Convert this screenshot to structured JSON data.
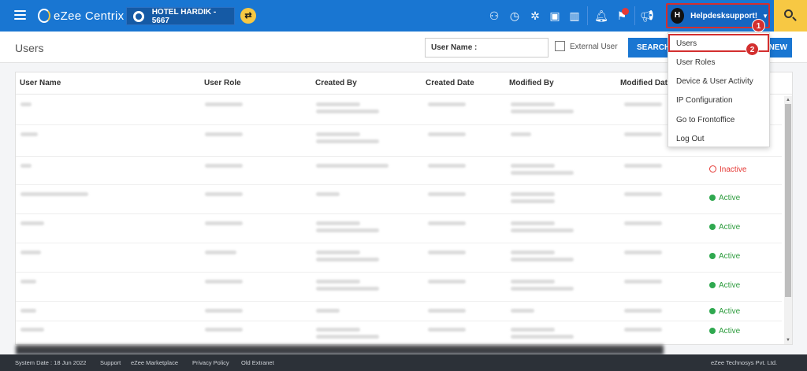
{
  "topbar": {
    "app_name": "eZee Centrix",
    "hotel_label": "HOTEL HARDIK -  5667",
    "user_initial": "H",
    "user_name": "Helpdesksupport!",
    "notification_badge": "",
    "icons": [
      "menu-icon",
      "hotel-globe-icon",
      "swap-icon",
      "team-icon",
      "calendar-icon",
      "network-icon",
      "clipboard-icon",
      "report-chart-icon",
      "bell-icon",
      "flag-icon",
      "megaphone-icon",
      "search-icon"
    ]
  },
  "subheader": {
    "title": "Users",
    "username_placeholder": "User Name :",
    "external_user_label": "External User",
    "search_label": "SEARCH",
    "new_label": "NEW"
  },
  "table": {
    "columns": [
      "User Name",
      "User Role",
      "Created By",
      "Created Date",
      "Modified By",
      "Modified Date"
    ],
    "rows": [
      {
        "status": ""
      },
      {
        "status": ""
      },
      {
        "status": "Inactive"
      },
      {
        "status": "Active"
      },
      {
        "status": "Active"
      },
      {
        "status": "Active"
      },
      {
        "status": "Active"
      },
      {
        "status": "Active"
      },
      {
        "status": "Active"
      }
    ]
  },
  "user_menu": {
    "items": [
      "Users",
      "User Roles",
      "Device & User Activity",
      "IP Configuration",
      "Go to Frontoffice",
      "Log Out"
    ]
  },
  "callouts": [
    "1",
    "2"
  ],
  "footer": {
    "system_date": "System Date : 18 Jun 2022",
    "links": [
      "Support",
      "eZee Marketplace",
      "Privacy Policy",
      "Old Extranet"
    ],
    "copyright": "eZee Technosys Pvt. Ltd."
  },
  "colors": {
    "primary": "#1976d2",
    "accent": "#f7c843",
    "highlight": "#d32f2f",
    "active": "#2fa84f",
    "footer": "#2c3138"
  }
}
